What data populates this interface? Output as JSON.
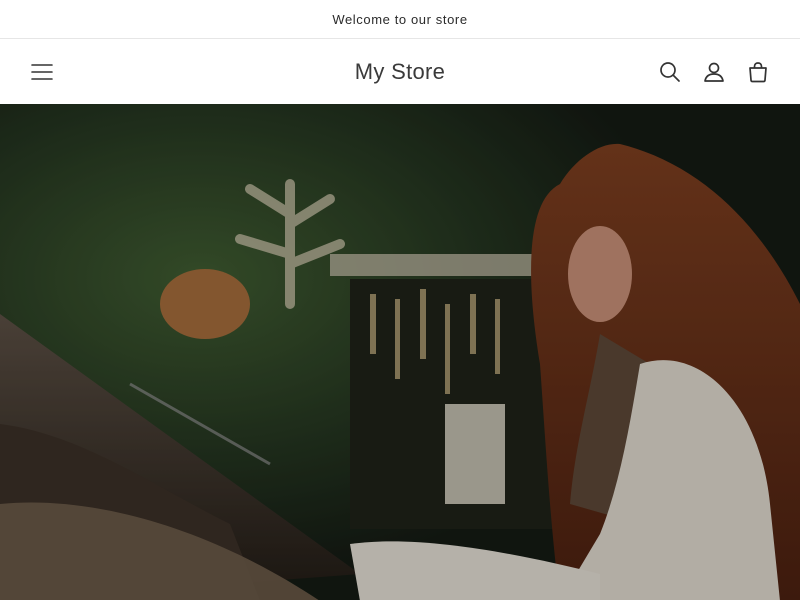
{
  "announcement": {
    "text": "Welcome to our store"
  },
  "header": {
    "title": "My Store",
    "icons": {
      "menu": "hamburger-menu-icon",
      "search": "search-icon",
      "account": "account-icon",
      "cart": "cart-icon"
    }
  },
  "hero": {
    "image": "woman-shopping-in-clothing-store"
  },
  "colors": {
    "text": "#121212",
    "border": "#e6e6e6",
    "background": "#ffffff"
  }
}
